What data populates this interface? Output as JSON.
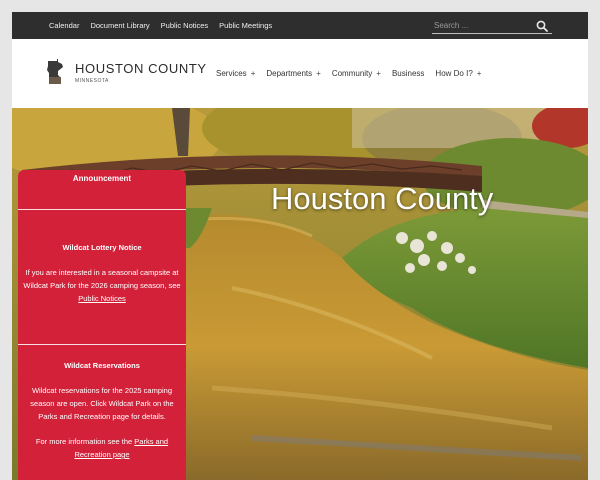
{
  "topbar": {
    "links": [
      "Calendar",
      "Document Library",
      "Public Notices",
      "Public Meetings"
    ],
    "search_placeholder": "Search ...",
    "search_icon": "search-icon"
  },
  "header": {
    "logo_icon": "minnesota-map-icon",
    "site_title": "HOUSTON COUNTY",
    "site_subtitle": "MINNESOTA",
    "nav": [
      {
        "label": "Services",
        "expand": "+"
      },
      {
        "label": "Departments",
        "expand": "+"
      },
      {
        "label": "Community",
        "expand": "+"
      },
      {
        "label": "Business",
        "expand": ""
      },
      {
        "label": "How Do I?",
        "expand": "+"
      }
    ]
  },
  "hero": {
    "title": "Houston County"
  },
  "announcement": {
    "heading": "Announcement",
    "lottery": {
      "title": "Wildcat Lottery Notice",
      "text_before": "If you are interested in a seasonal campsite at Wildcat Park for the 2026 camping season, see",
      "link": "Public Notices"
    },
    "reservations": {
      "title": "Wildcat Reservations",
      "text": "Wildcat reservations for the 2025 camping season are open. Click Wildcat Park on the Parks and Recreation page for details.",
      "more_before": "For more information see the",
      "more_link": "Parks and Recreation page"
    }
  },
  "colors": {
    "topbar_bg": "#2e2e2e",
    "panel_bg": "#d3213a",
    "page_bg": "#e6e6e6"
  }
}
